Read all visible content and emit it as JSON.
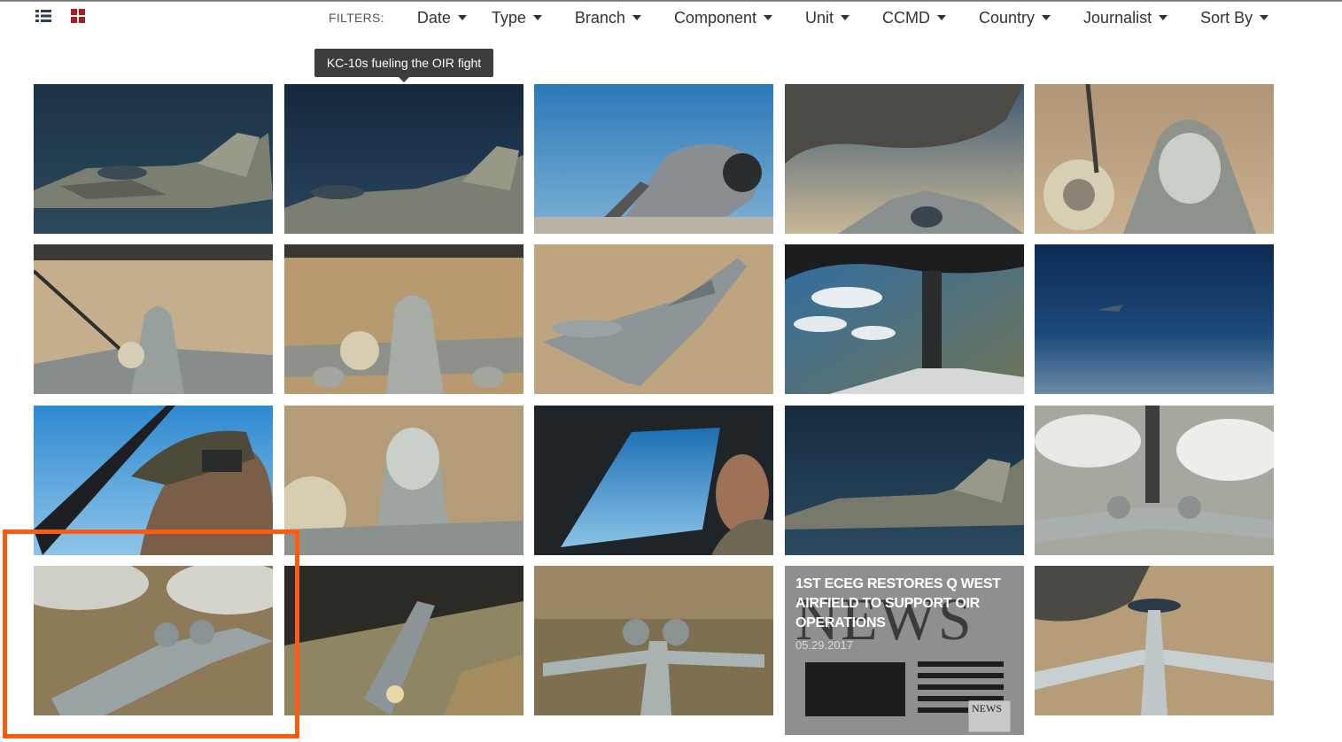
{
  "toolbar": {
    "list_view_icon": "list-icon",
    "grid_view_icon": "grid-icon",
    "grid_icon_color": "#a51c24"
  },
  "filters": {
    "label": "FILTERS:",
    "items": [
      "Date",
      "Type",
      "Branch",
      "Component",
      "Unit",
      "CCMD",
      "Country",
      "Journalist",
      "Sort By"
    ]
  },
  "tooltip": {
    "text": "KC-10s fueling the OIR fight"
  },
  "gallery": {
    "news_card": {
      "title": "1st ECEG restores Q West airfield to support OIR operations",
      "date": "05.29.2017",
      "background_word": "NEWS",
      "badge": "NEWS"
    }
  },
  "highlight": {
    "color": "#ff5a12"
  }
}
